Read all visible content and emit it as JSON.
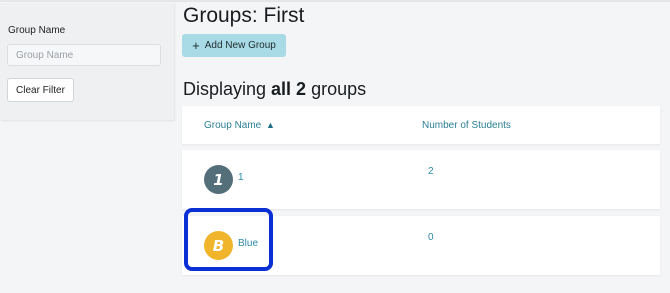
{
  "filter": {
    "label": "Group Name",
    "placeholder": "Group Name",
    "value": "",
    "clear_label": "Clear Filter"
  },
  "page": {
    "title": "Groups: First",
    "add_label": "Add New Group",
    "add_icon": "plus-icon",
    "display_prefix": "Displaying ",
    "display_bold": "all 2",
    "display_suffix": " groups"
  },
  "table": {
    "columns": [
      {
        "label": "Group Name",
        "sort_indicator": "▲"
      },
      {
        "label": "Number of Students"
      }
    ],
    "rows": [
      {
        "avatar_letter": "1",
        "avatar_color": "#546e7a",
        "name": "1",
        "count": "2"
      },
      {
        "avatar_letter": "B",
        "avatar_color": "#f0b52a",
        "name": "Blue",
        "count": "0"
      }
    ]
  },
  "colors": {
    "accent_button": "#a8dbe5",
    "link": "#2a8aa6",
    "highlight": "#0a2fd4"
  }
}
